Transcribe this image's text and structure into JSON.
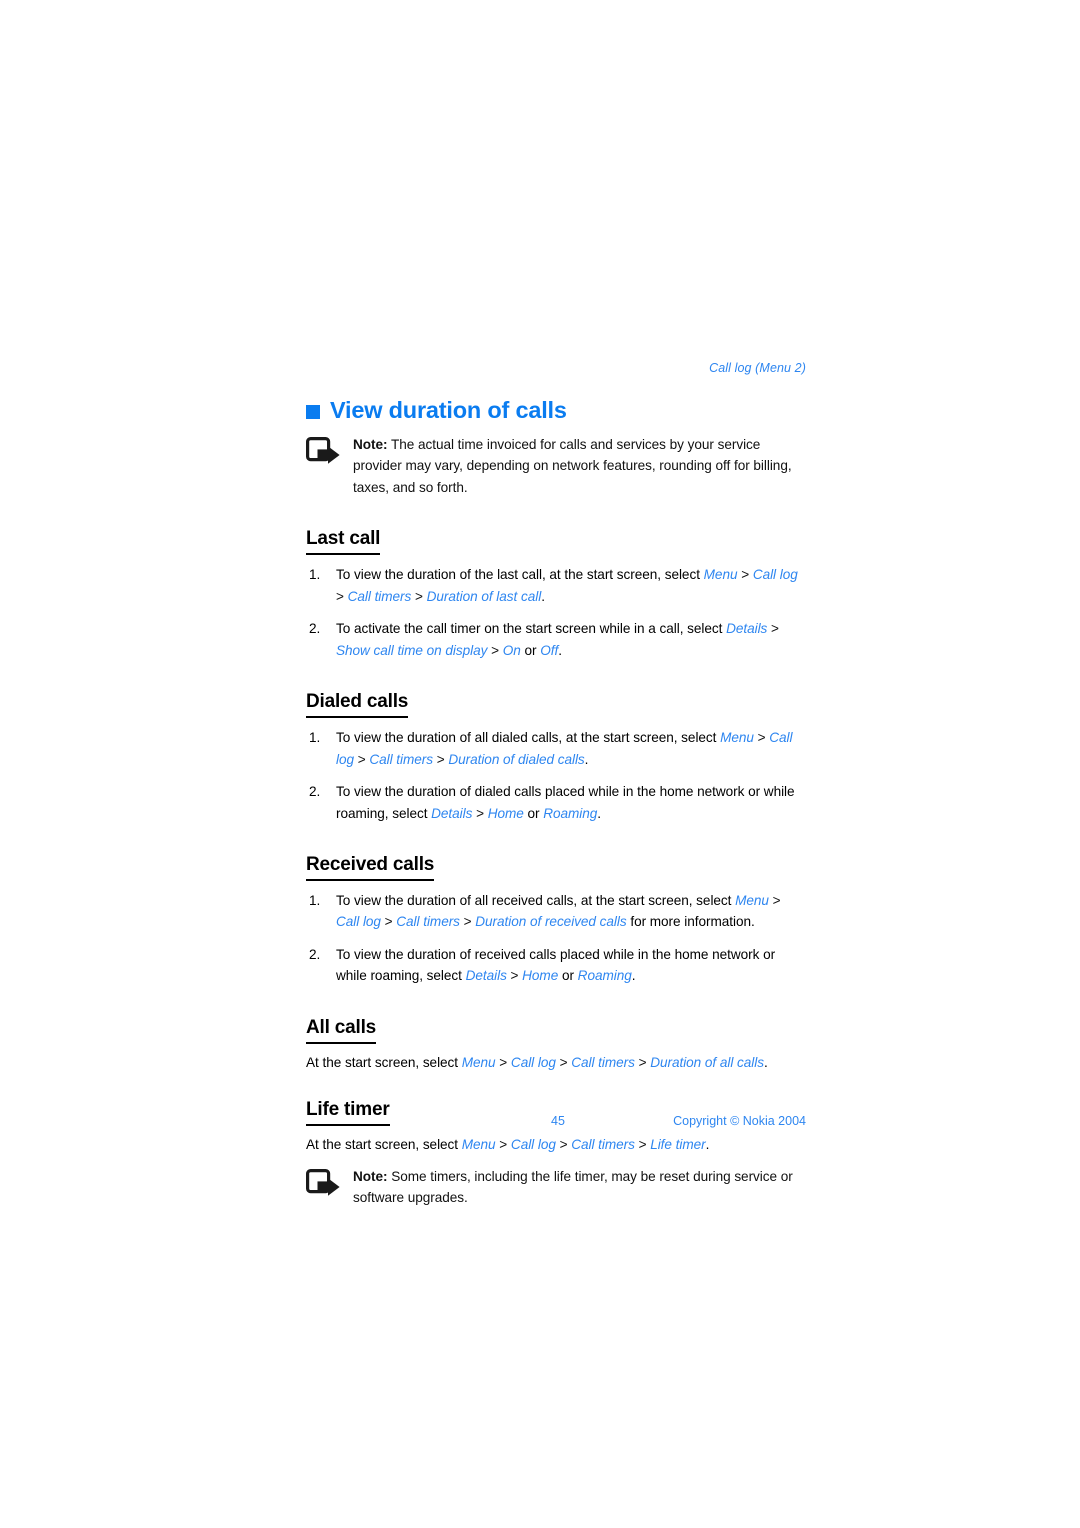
{
  "document": {
    "running_header": "Call log (Menu 2)",
    "chapter_title": "View duration of calls",
    "accent_color": "#0a7cf0",
    "link_color": "#2e86f0"
  },
  "top_note": {
    "label": "Note:",
    "text": " The actual time invoiced for calls and services by your service provider may vary, depending on network features, rounding off for billing, taxes, and so forth."
  },
  "sections": {
    "last_call": {
      "heading": "Last call",
      "step1": {
        "num": "1.",
        "t1": "To view the duration of the last call, at the start screen, select ",
        "ui1": "Menu",
        "s1": " > ",
        "ui2": "Call log",
        "s2": " > ",
        "ui3": "Call timers",
        "s3": " > ",
        "ui4": "Duration of last call",
        "t2": "."
      },
      "step2": {
        "num": "2.",
        "t1": "To activate the call timer on the start screen while in a call, select ",
        "ui1": "Details",
        "s1": " > ",
        "ui2": "Show call time on display",
        "s2": " > ",
        "ui3": "On",
        "t2": " or ",
        "ui4": "Off",
        "t3": "."
      }
    },
    "dialed_calls": {
      "heading": "Dialed calls",
      "step1": {
        "num": "1.",
        "t1": "To view the duration of all dialed calls, at the start screen, select ",
        "ui1": "Menu",
        "s1": " > ",
        "ui2": "Call log",
        "s2": " > ",
        "ui3": "Call timers",
        "s3": " > ",
        "ui4": "Duration of dialed calls",
        "t2": "."
      },
      "step2": {
        "num": "2.",
        "t1": "To view the duration of dialed calls placed while in the home network or while roaming, select ",
        "ui1": "Details",
        "s1": " > ",
        "ui2": "Home",
        "t2": " or ",
        "ui3": "Roaming",
        "t3": "."
      }
    },
    "received_calls": {
      "heading": "Received calls",
      "step1": {
        "num": "1.",
        "t1": "To view the duration of all received calls, at the start screen, select ",
        "ui1": "Menu",
        "s1": " > ",
        "ui2": "Call log",
        "s2": " > ",
        "ui3": "Call timers",
        "s3": " > ",
        "ui4": "Duration of received calls",
        "t2": " for more information."
      },
      "step2": {
        "num": "2.",
        "t1": "To view the duration of received calls placed while in the home network or while roaming, select ",
        "ui1": "Details",
        "s1": " > ",
        "ui2": "Home",
        "t2": " or ",
        "ui3": "Roaming",
        "t3": "."
      }
    },
    "all_calls": {
      "heading": "All calls",
      "para": {
        "t1": "At the start screen, select ",
        "ui1": "Menu",
        "s1": " > ",
        "ui2": "Call log",
        "s2": " > ",
        "ui3": "Call timers",
        "s3": " > ",
        "ui4": "Duration of all calls",
        "t2": "."
      }
    },
    "life_timer": {
      "heading": "Life timer",
      "para": {
        "t1": "At the start screen, select ",
        "ui1": "Menu",
        "s1": " > ",
        "ui2": "Call log",
        "s2": " > ",
        "ui3": "Call timers",
        "s3": " > ",
        "ui4": "Life timer",
        "t2": "."
      },
      "note": {
        "label": "Note:",
        "text": " Some timers, including the life timer, may be reset during service or software upgrades."
      }
    }
  },
  "footer": {
    "page_number": "45",
    "copyright": "Copyright © Nokia 2004"
  }
}
